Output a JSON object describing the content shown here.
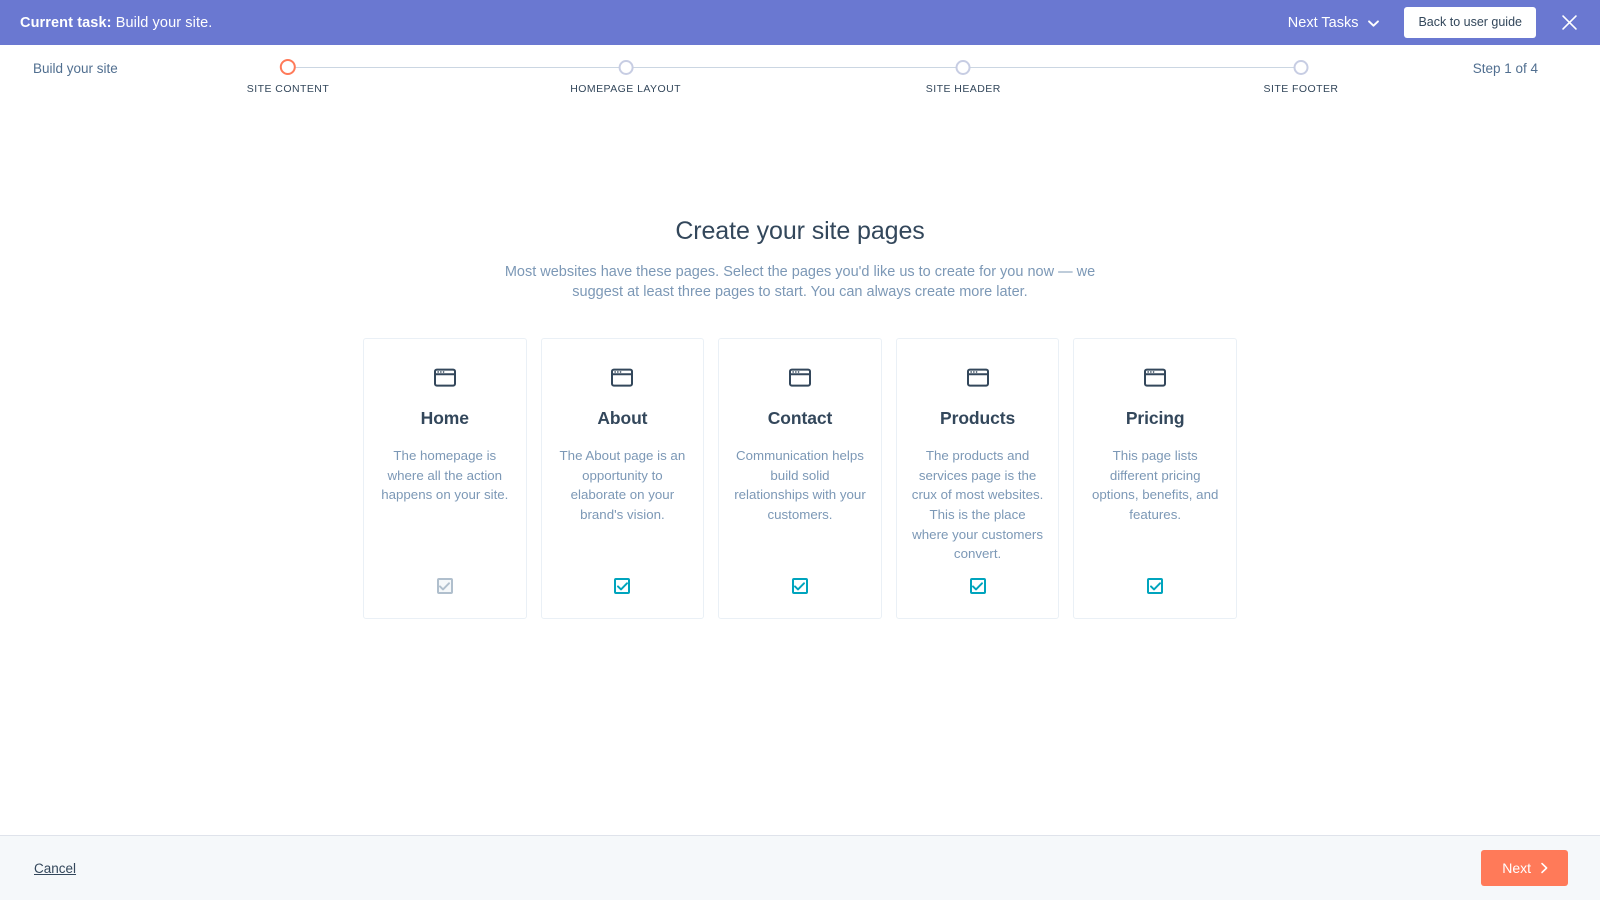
{
  "banner": {
    "task_label": "Current task:",
    "task_value": "Build your site.",
    "next_tasks_label": "Next Tasks",
    "next_tasks_icon": "chevron-down-icon",
    "back_button_label": "Back to user guide",
    "close_icon": "close-icon",
    "background_color": "#6a78d1"
  },
  "stepper": {
    "title": "Build your site",
    "step_counter": "Step 1 of 4",
    "active_index": 0,
    "active_color": "#ff7a59",
    "inactive_color": "#c7cde3",
    "steps": [
      {
        "label": "SITE CONTENT"
      },
      {
        "label": "HOMEPAGE LAYOUT"
      },
      {
        "label": "SITE HEADER"
      },
      {
        "label": "SITE FOOTER"
      }
    ]
  },
  "main": {
    "title": "Create your site pages",
    "subtitle": "Most websites have these pages. Select the pages you'd like us to create for you now — we suggest at least three pages to start. You can always create more later.",
    "cards": [
      {
        "title": "Home",
        "description": "The homepage is where all the action happens on your site.",
        "icon": "browser-window-icon",
        "checked": true,
        "disabled": true
      },
      {
        "title": "About",
        "description": "The About page is an opportunity to elaborate on your brand's vision.",
        "icon": "browser-window-icon",
        "checked": true,
        "disabled": false
      },
      {
        "title": "Contact",
        "description": "Communication helps build solid relationships with your customers.",
        "icon": "browser-window-icon",
        "checked": true,
        "disabled": false
      },
      {
        "title": "Products",
        "description": "The products and services page is the crux of most websites. This is the place where your customers convert.",
        "icon": "browser-window-icon",
        "checked": true,
        "disabled": false
      },
      {
        "title": "Pricing",
        "description": "This page lists different pricing options, benefits, and features.",
        "icon": "browser-window-icon",
        "checked": true,
        "disabled": false
      }
    ],
    "checkbox_color": "#00a4bd",
    "checkbox_disabled_color": "#b0bfcd"
  },
  "footer": {
    "cancel_label": "Cancel",
    "next_label": "Next",
    "next_icon": "chevron-right-icon",
    "next_color": "#ff7a59"
  }
}
